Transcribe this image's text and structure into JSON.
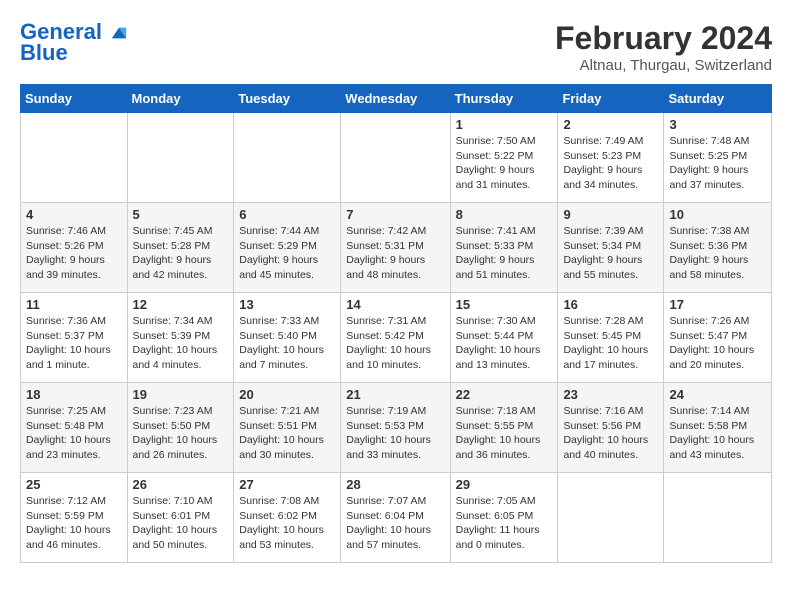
{
  "header": {
    "logo_line1": "General",
    "logo_line2": "Blue",
    "month_year": "February 2024",
    "location": "Altnau, Thurgau, Switzerland"
  },
  "days_of_week": [
    "Sunday",
    "Monday",
    "Tuesday",
    "Wednesday",
    "Thursday",
    "Friday",
    "Saturday"
  ],
  "weeks": [
    [
      {
        "day": "",
        "info": ""
      },
      {
        "day": "",
        "info": ""
      },
      {
        "day": "",
        "info": ""
      },
      {
        "day": "",
        "info": ""
      },
      {
        "day": "1",
        "info": "Sunrise: 7:50 AM\nSunset: 5:22 PM\nDaylight: 9 hours and 31 minutes."
      },
      {
        "day": "2",
        "info": "Sunrise: 7:49 AM\nSunset: 5:23 PM\nDaylight: 9 hours and 34 minutes."
      },
      {
        "day": "3",
        "info": "Sunrise: 7:48 AM\nSunset: 5:25 PM\nDaylight: 9 hours and 37 minutes."
      }
    ],
    [
      {
        "day": "4",
        "info": "Sunrise: 7:46 AM\nSunset: 5:26 PM\nDaylight: 9 hours and 39 minutes."
      },
      {
        "day": "5",
        "info": "Sunrise: 7:45 AM\nSunset: 5:28 PM\nDaylight: 9 hours and 42 minutes."
      },
      {
        "day": "6",
        "info": "Sunrise: 7:44 AM\nSunset: 5:29 PM\nDaylight: 9 hours and 45 minutes."
      },
      {
        "day": "7",
        "info": "Sunrise: 7:42 AM\nSunset: 5:31 PM\nDaylight: 9 hours and 48 minutes."
      },
      {
        "day": "8",
        "info": "Sunrise: 7:41 AM\nSunset: 5:33 PM\nDaylight: 9 hours and 51 minutes."
      },
      {
        "day": "9",
        "info": "Sunrise: 7:39 AM\nSunset: 5:34 PM\nDaylight: 9 hours and 55 minutes."
      },
      {
        "day": "10",
        "info": "Sunrise: 7:38 AM\nSunset: 5:36 PM\nDaylight: 9 hours and 58 minutes."
      }
    ],
    [
      {
        "day": "11",
        "info": "Sunrise: 7:36 AM\nSunset: 5:37 PM\nDaylight: 10 hours and 1 minute."
      },
      {
        "day": "12",
        "info": "Sunrise: 7:34 AM\nSunset: 5:39 PM\nDaylight: 10 hours and 4 minutes."
      },
      {
        "day": "13",
        "info": "Sunrise: 7:33 AM\nSunset: 5:40 PM\nDaylight: 10 hours and 7 minutes."
      },
      {
        "day": "14",
        "info": "Sunrise: 7:31 AM\nSunset: 5:42 PM\nDaylight: 10 hours and 10 minutes."
      },
      {
        "day": "15",
        "info": "Sunrise: 7:30 AM\nSunset: 5:44 PM\nDaylight: 10 hours and 13 minutes."
      },
      {
        "day": "16",
        "info": "Sunrise: 7:28 AM\nSunset: 5:45 PM\nDaylight: 10 hours and 17 minutes."
      },
      {
        "day": "17",
        "info": "Sunrise: 7:26 AM\nSunset: 5:47 PM\nDaylight: 10 hours and 20 minutes."
      }
    ],
    [
      {
        "day": "18",
        "info": "Sunrise: 7:25 AM\nSunset: 5:48 PM\nDaylight: 10 hours and 23 minutes."
      },
      {
        "day": "19",
        "info": "Sunrise: 7:23 AM\nSunset: 5:50 PM\nDaylight: 10 hours and 26 minutes."
      },
      {
        "day": "20",
        "info": "Sunrise: 7:21 AM\nSunset: 5:51 PM\nDaylight: 10 hours and 30 minutes."
      },
      {
        "day": "21",
        "info": "Sunrise: 7:19 AM\nSunset: 5:53 PM\nDaylight: 10 hours and 33 minutes."
      },
      {
        "day": "22",
        "info": "Sunrise: 7:18 AM\nSunset: 5:55 PM\nDaylight: 10 hours and 36 minutes."
      },
      {
        "day": "23",
        "info": "Sunrise: 7:16 AM\nSunset: 5:56 PM\nDaylight: 10 hours and 40 minutes."
      },
      {
        "day": "24",
        "info": "Sunrise: 7:14 AM\nSunset: 5:58 PM\nDaylight: 10 hours and 43 minutes."
      }
    ],
    [
      {
        "day": "25",
        "info": "Sunrise: 7:12 AM\nSunset: 5:59 PM\nDaylight: 10 hours and 46 minutes."
      },
      {
        "day": "26",
        "info": "Sunrise: 7:10 AM\nSunset: 6:01 PM\nDaylight: 10 hours and 50 minutes."
      },
      {
        "day": "27",
        "info": "Sunrise: 7:08 AM\nSunset: 6:02 PM\nDaylight: 10 hours and 53 minutes."
      },
      {
        "day": "28",
        "info": "Sunrise: 7:07 AM\nSunset: 6:04 PM\nDaylight: 10 hours and 57 minutes."
      },
      {
        "day": "29",
        "info": "Sunrise: 7:05 AM\nSunset: 6:05 PM\nDaylight: 11 hours and 0 minutes."
      },
      {
        "day": "",
        "info": ""
      },
      {
        "day": "",
        "info": ""
      }
    ]
  ]
}
